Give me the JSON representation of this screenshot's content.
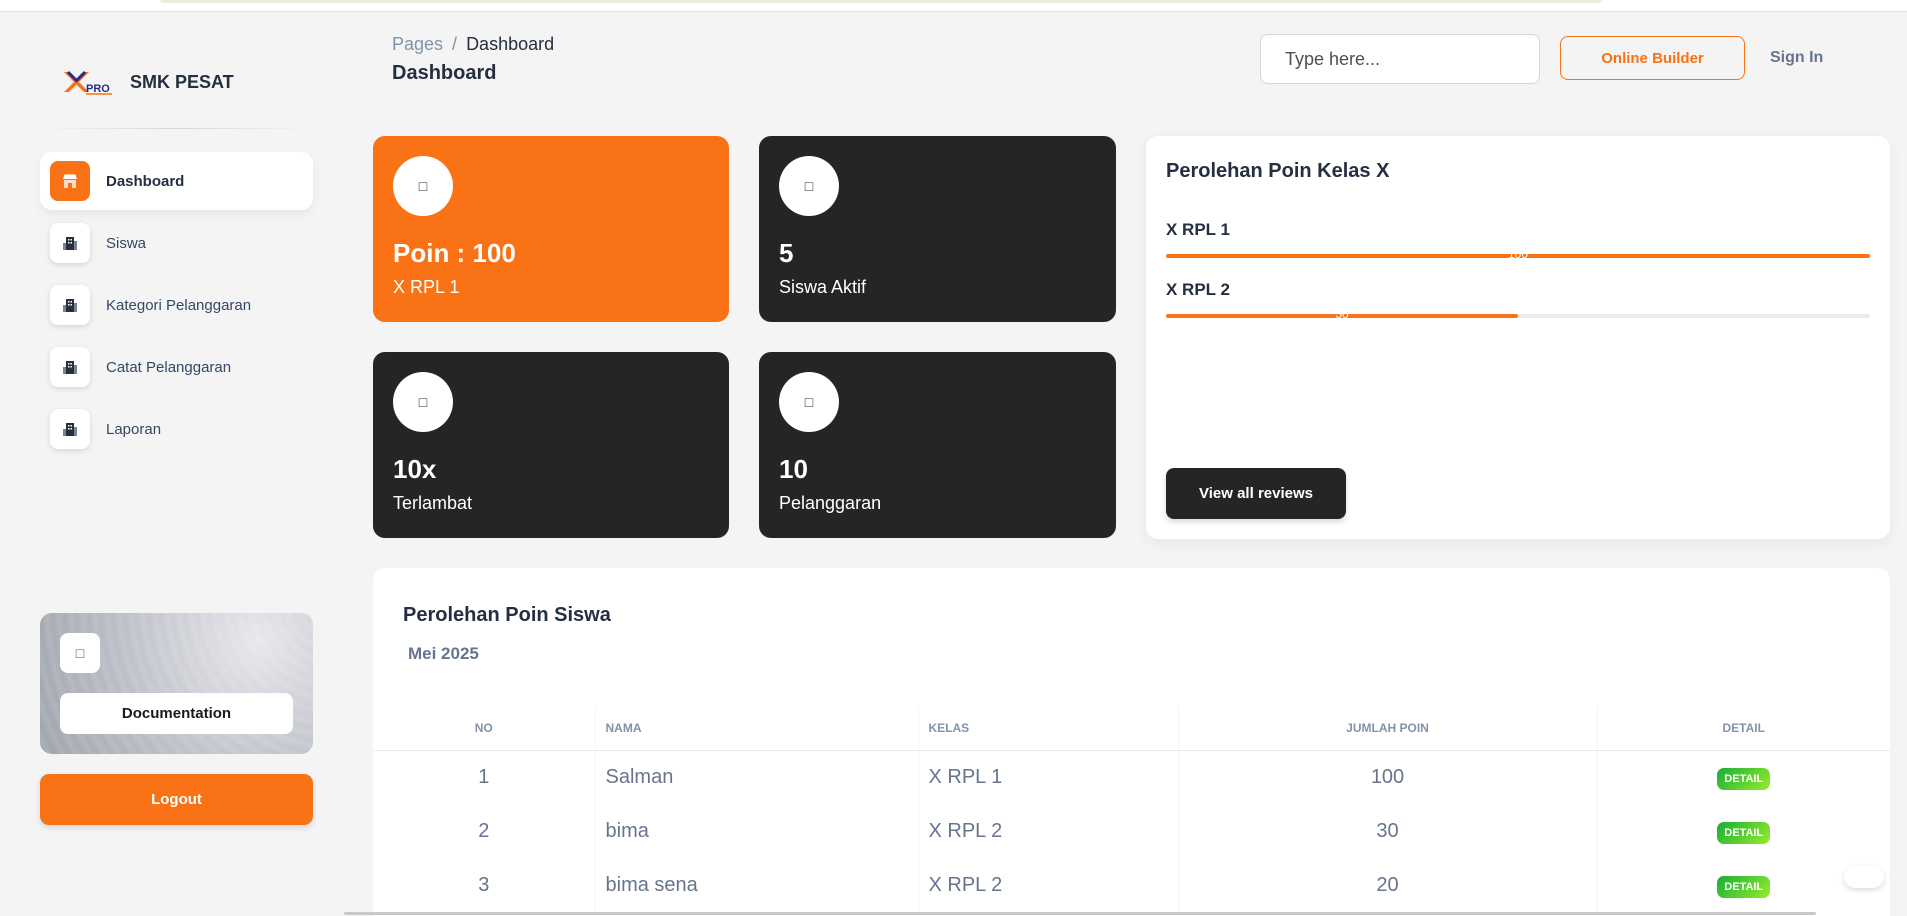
{
  "brand": {
    "name": "SMK PESAT",
    "logo_text": "PRO"
  },
  "sidebar": {
    "items": [
      {
        "label": "Dashboard",
        "icon": "shop-icon",
        "active": true
      },
      {
        "label": "Siswa",
        "icon": "office-icon",
        "active": false
      },
      {
        "label": "Kategori Pelanggaran",
        "icon": "office-icon",
        "active": false
      },
      {
        "label": "Catat Pelanggaran",
        "icon": "office-icon",
        "active": false
      },
      {
        "label": "Laporan",
        "icon": "office-icon",
        "active": false
      }
    ],
    "doc_icon": "□",
    "doc_label": "Documentation",
    "logout_label": "Logout"
  },
  "header": {
    "breadcrumb_root": "Pages",
    "breadcrumb_sep": "/",
    "breadcrumb_current": "Dashboard",
    "title": "Dashboard",
    "search_placeholder": "Type here...",
    "online_builder": "Online Builder",
    "sign_in": "Sign In"
  },
  "stats": [
    {
      "icon": "□",
      "value": "Poin : 100",
      "label": "X RPL 1",
      "color": "#f97316"
    },
    {
      "icon": "□",
      "value": "5",
      "label": "Siswa Aktif",
      "color": "#252528"
    },
    {
      "icon": "□",
      "value": "10x",
      "label": "Terlambat",
      "color": "#252528"
    },
    {
      "icon": "□",
      "value": "10",
      "label": "Pelanggaran",
      "color": "#252528"
    }
  ],
  "kelas": {
    "title": "Perolehan Poin Kelas X",
    "bars": [
      {
        "label": "X RPL 1",
        "value": 100,
        "display": "100",
        "fraction": 1.0
      },
      {
        "label": "X RPL 2",
        "value": 50,
        "display": "50",
        "fraction": 0.5
      }
    ],
    "view_all": "View all reviews"
  },
  "table": {
    "title": "Perolehan Poin Siswa",
    "subtitle": "Mei 2025",
    "columns": [
      "No",
      "Nama",
      "Kelas",
      "Jumlah Poin",
      "Detail"
    ],
    "rows": [
      {
        "no": "1",
        "nama": "Salman",
        "kelas": "X RPL 1",
        "poin": "100",
        "detail": "DETAIL"
      },
      {
        "no": "2",
        "nama": "bima",
        "kelas": "X RPL 2",
        "poin": "30",
        "detail": "DETAIL"
      },
      {
        "no": "3",
        "nama": "bima sena",
        "kelas": "X RPL 2",
        "poin": "20",
        "detail": "DETAIL"
      }
    ]
  },
  "colors": {
    "accent": "#f97316",
    "dark": "#252528",
    "success": "#17ad37"
  }
}
